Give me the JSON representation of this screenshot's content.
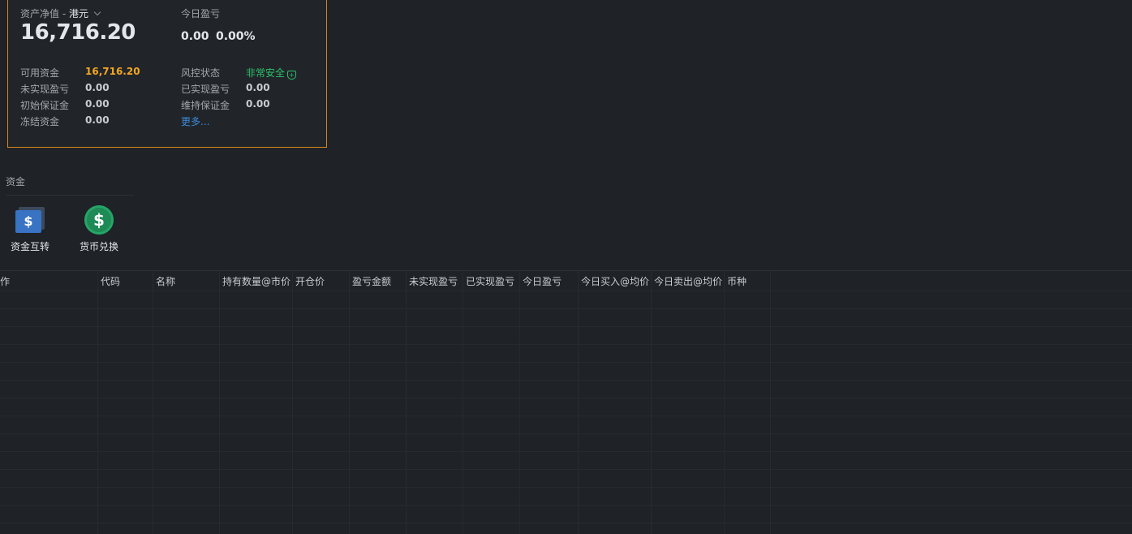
{
  "summary": {
    "net_value_label": "资产净值 -",
    "currency": "港元",
    "net_value": "16,716.20",
    "today_pl_label": "今日盈亏",
    "today_pl_value": "0.00",
    "today_pl_percent": "0.00%",
    "available_funds_label": "可用资金",
    "available_funds": "16,716.20",
    "unrealized_pl_label": "未实现盈亏",
    "unrealized_pl": "0.00",
    "initial_margin_label": "初始保证金",
    "initial_margin": "0.00",
    "frozen_funds_label": "冻结资金",
    "frozen_funds": "0.00",
    "risk_status_label": "风控状态",
    "risk_status": "非常安全",
    "realized_pl_label": "已实现盈亏",
    "realized_pl": "0.00",
    "maintenance_margin_label": "维持保证金",
    "maintenance_margin": "0.00",
    "more_link": "更多..."
  },
  "funds_section": {
    "title": "资金",
    "tools": [
      {
        "label": "资金互转",
        "icon": "dollar-transfer-icon"
      },
      {
        "label": "货币兑换",
        "icon": "currency-exchange-icon"
      }
    ]
  },
  "positions_table": {
    "columns": [
      "作",
      "代码",
      "名称",
      "持有数量@市价",
      "开仓价",
      "盈亏金额",
      "未实现盈亏",
      "已实现盈亏",
      "今日盈亏",
      "今日买入@均价",
      "今日卖出@均价",
      "币种"
    ]
  },
  "colors": {
    "accent_border": "#d4881c",
    "orange_value": "#f5a623",
    "safe_green": "#2bc16a",
    "link_blue": "#3d8bd9"
  }
}
